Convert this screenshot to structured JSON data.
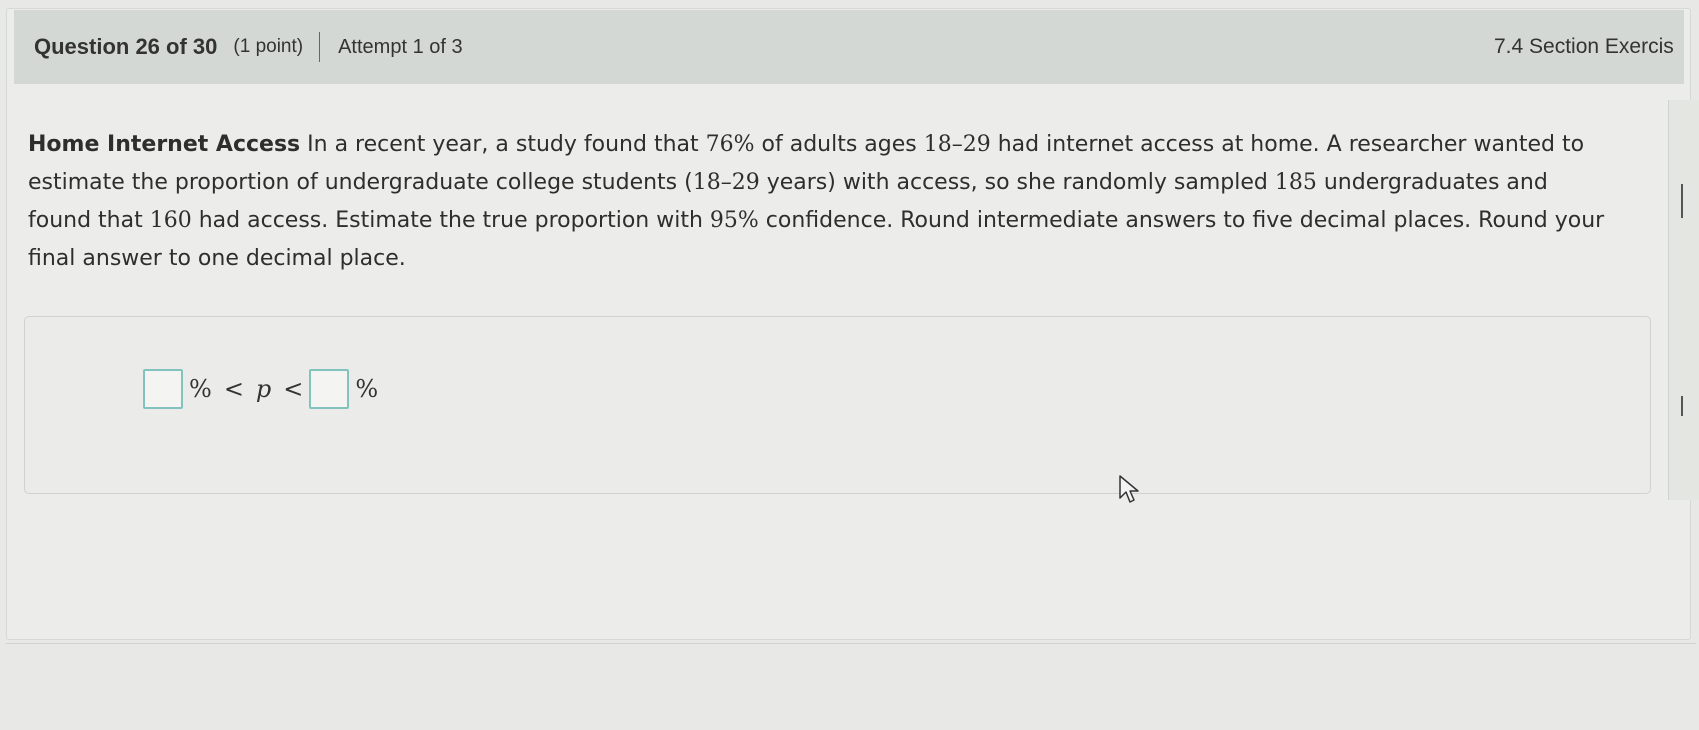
{
  "header": {
    "question": "Question 26 of 30",
    "points": "(1 point)",
    "attempt": "Attempt 1 of 3",
    "section": "7.4 Section Exercis"
  },
  "problem": {
    "title": "Home Internet Access",
    "segment_1": " In a recent year, a study found that ",
    "pct_76": "76%",
    "segment_2": " of adults ages ",
    "ages_1": "18–29",
    "segment_3": " had internet access at home. A researcher wanted to estimate the proportion of undergraduate college students (",
    "ages_2": "18–29",
    "segment_4": " years) with access, so she randomly sampled ",
    "n_185": "185",
    "segment_5": " undergraduates and found that ",
    "x_160": "160",
    "segment_6": " had access. Estimate the true proportion with ",
    "conf_95": "95%",
    "segment_7": " confidence. Round intermediate answers to five decimal places. Round your final answer to one decimal place."
  },
  "answer": {
    "lower_value": "",
    "upper_value": "",
    "percent_1": "%",
    "lt_1": "<",
    "variable": "p",
    "lt_2": "<",
    "percent_2": "%"
  },
  "colors": {
    "header_bg": "#d4d8d5",
    "page_bg": "#e8e9e6",
    "answer_box_border": "#82c4bd"
  }
}
